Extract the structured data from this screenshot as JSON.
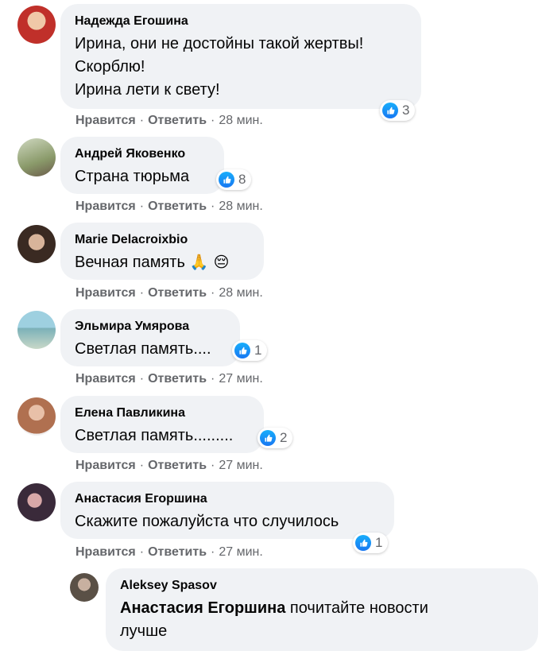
{
  "actions": {
    "like": "Нравится",
    "reply": "Ответить",
    "separator": "·"
  },
  "comments": [
    {
      "author": "Надежда Егошина",
      "text": "Ирина, они не достойны такой жертвы!\nСкорблю!\nИрина лети к свету!",
      "time": "28 мин.",
      "likes": "3",
      "avatar_color": "#d33a2c"
    },
    {
      "author": "Андрей Яковенко",
      "text": "Страна тюрьма",
      "time": "28 мин.",
      "likes": "8",
      "avatar_color": "#8a9a6a"
    },
    {
      "author": "Marie Delacroixbio",
      "text": "Вечная память",
      "emoji": [
        "🙏",
        "😔"
      ],
      "time": "28 мин.",
      "avatar_color": "#6a4a3a"
    },
    {
      "author": "Эльмира Умярова",
      "text": "Светлая память....",
      "time": "27 мин.",
      "likes": "1",
      "avatar_color": "#7ab0b8"
    },
    {
      "author": "Елена Павликина",
      "text": "Светлая память.........",
      "time": "27 мин.",
      "likes": "2",
      "avatar_color": "#b07050"
    },
    {
      "author": "Анастасия Егоршина",
      "text": "Скажите пожалуйста что случилось",
      "time": "27 мин.",
      "likes": "1",
      "avatar_color": "#3a2a3a"
    }
  ],
  "reply": {
    "author": "Aleksey Spasov",
    "mention": "Анастасия Егоршина",
    "text": " почитайте новости\nлучше",
    "avatar_color": "#5a5046"
  },
  "colors": {
    "bubble": "#f0f2f5",
    "secondary_text": "#65676b",
    "like_blue": "#1877f2"
  }
}
